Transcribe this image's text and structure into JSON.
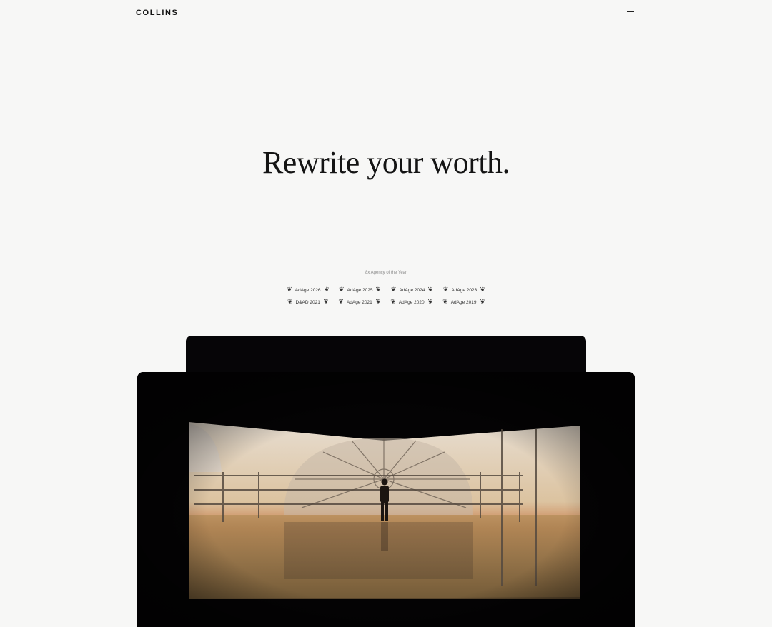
{
  "header": {
    "logo_text": "COLLINS",
    "menu_icon": "hamburger-icon"
  },
  "hero": {
    "headline": "Rewrite your worth."
  },
  "awards": {
    "caption": "8x Agency of the Year",
    "row1": [
      "AdAge 2026",
      "AdAge 2025",
      "AdAge 2024",
      "AdAge 2023"
    ],
    "row2": [
      "D&AD 2021",
      "AdAge 2021",
      "AdAge 2020",
      "AdAge 2019"
    ],
    "laurel_icon": "laurel-icon"
  },
  "colors": {
    "background": "#f7f7f6",
    "text": "#141414",
    "video_frame": "#040304"
  }
}
